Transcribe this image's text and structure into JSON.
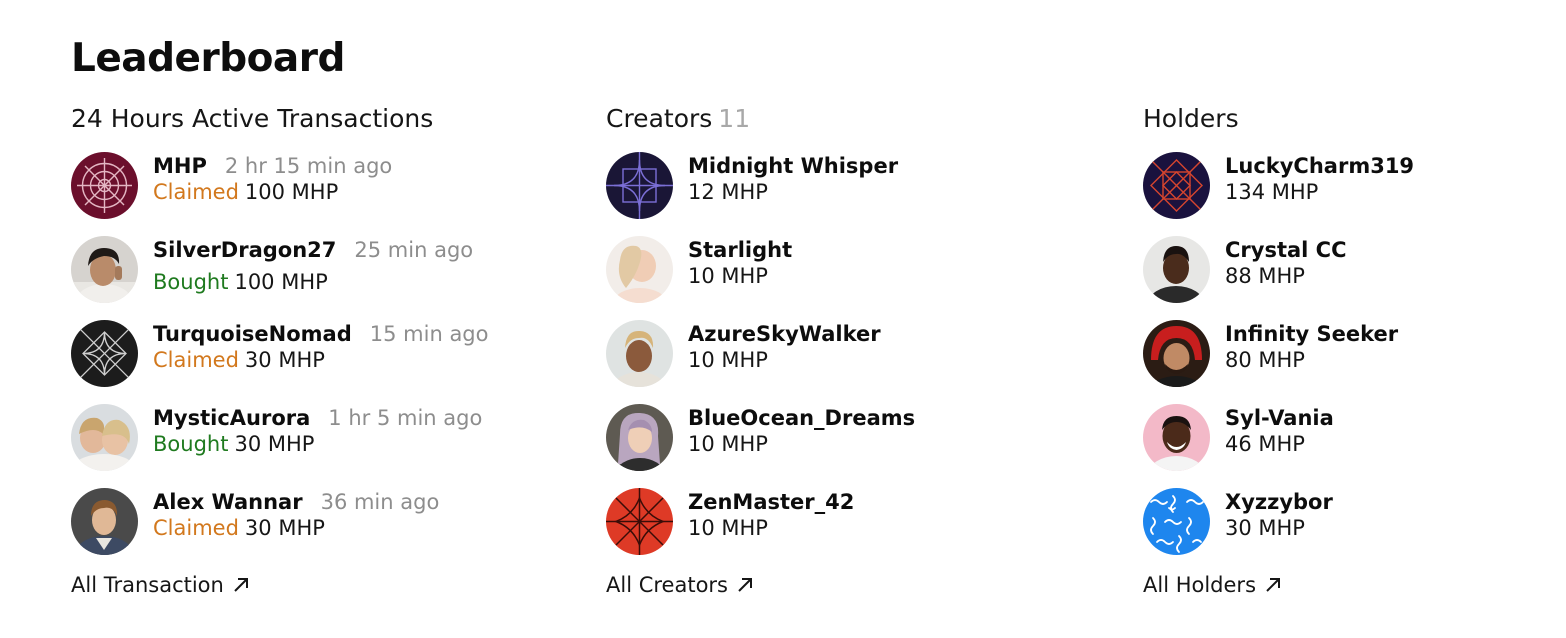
{
  "title": "Leaderboard",
  "transactions": {
    "heading": "24 Hours Active Transactions",
    "items": [
      {
        "name": "MHP",
        "time": "2 hr 15 min ago",
        "action": "Claimed",
        "amount": "100 MHP"
      },
      {
        "name": "SilverDragon27",
        "time": "25 min ago",
        "action": "Bought",
        "amount": "100 MHP"
      },
      {
        "name": "TurquoiseNomad",
        "time": "15 min ago",
        "action": "Claimed",
        "amount": "30 MHP"
      },
      {
        "name": "MysticAurora",
        "time": "1 hr 5 min ago",
        "action": "Bought",
        "amount": "30 MHP"
      },
      {
        "name": "Alex Wannar",
        "time": "36 min ago",
        "action": "Claimed",
        "amount": "30 MHP"
      }
    ],
    "footer": "All Transaction"
  },
  "creators": {
    "heading": "Creators",
    "count": "11",
    "items": [
      {
        "name": "Midnight Whisper",
        "amount": "12 MHP"
      },
      {
        "name": "Starlight",
        "amount": "10 MHP"
      },
      {
        "name": "AzureSkyWalker",
        "amount": "10 MHP"
      },
      {
        "name": "BlueOcean_Dreams",
        "amount": "10 MHP"
      },
      {
        "name": "ZenMaster_42",
        "amount": "10 MHP"
      }
    ],
    "footer": "All Creators"
  },
  "holders": {
    "heading": "Holders",
    "items": [
      {
        "name": "LuckyCharm319",
        "amount": "134 MHP"
      },
      {
        "name": "Crystal CC",
        "amount": "88 MHP"
      },
      {
        "name": "Infinity Seeker",
        "amount": "80 MHP"
      },
      {
        "name": "Syl-Vania",
        "amount": "46 MHP"
      },
      {
        "name": "Xyzzybor",
        "amount": "30 MHP"
      }
    ],
    "footer": "All Holders"
  },
  "colors": {
    "claimed": "#d2781d",
    "bought": "#1f7a1f",
    "muted": "#8d8d8d",
    "count": "#a8a8a8"
  },
  "icons": {
    "footer_link": "arrow-up-right-icon"
  }
}
